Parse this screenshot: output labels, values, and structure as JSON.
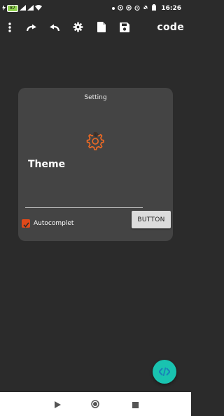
{
  "status_bar": {
    "battery_level": "87",
    "time": "16:26"
  },
  "toolbar": {
    "title": "code",
    "icons": [
      "more-vert-icon",
      "redo-icon",
      "undo-icon",
      "gear-icon",
      "file-icon",
      "save-icon"
    ]
  },
  "dialog": {
    "title": "Setting",
    "theme_label": "Theme",
    "autocomplete_label": "Autocomplet",
    "autocomplete_checked": true,
    "button_label": "BUTTON"
  },
  "colors": {
    "background": "#2b2b2b",
    "dialog": "#444444",
    "accent": "#e0491a",
    "fab": "#19c3b0"
  }
}
